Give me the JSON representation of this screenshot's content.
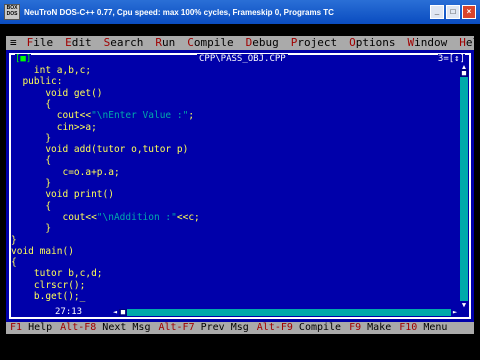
{
  "window": {
    "icon_text": "BOX DOS",
    "title": "NeuTroN DOS-C++ 0.77, Cpu speed: max 100% cycles, Frameskip  0, Programs  TC",
    "buttons": {
      "minimize": "_",
      "maximize": "□",
      "close": "×"
    }
  },
  "menubar": {
    "system": "≡",
    "items": [
      {
        "hot": "F",
        "rest": "ile"
      },
      {
        "hot": "E",
        "rest": "dit"
      },
      {
        "hot": "S",
        "rest": "earch"
      },
      {
        "hot": "R",
        "rest": "un"
      },
      {
        "hot": "C",
        "rest": "ompile"
      },
      {
        "hot": "D",
        "rest": "ebug"
      },
      {
        "hot": "P",
        "rest": "roject"
      },
      {
        "hot": "O",
        "rest": "ptions"
      },
      {
        "hot": "W",
        "rest": "indow"
      },
      {
        "hot": "H",
        "rest": "elp"
      }
    ]
  },
  "editor": {
    "title": "CPP\\PASS_OBJ.CPP",
    "left_marker": "[■]",
    "right_marker": "3=[↕]",
    "cursor_pos": "27:13",
    "lines": [
      {
        "text": "    int a,b,c;",
        "str": "",
        "tail": ""
      },
      {
        "text": "  public:",
        "str": "",
        "tail": ""
      },
      {
        "text": "      void get()",
        "str": "",
        "tail": ""
      },
      {
        "text": "      {",
        "str": "",
        "tail": ""
      },
      {
        "text": "        cout<<",
        "str": "\"\\nEnter Value :\"",
        "tail": ";"
      },
      {
        "text": "        cin>>a;",
        "str": "",
        "tail": ""
      },
      {
        "text": "      }",
        "str": "",
        "tail": ""
      },
      {
        "text": "      void add(tutor o,tutor p)",
        "str": "",
        "tail": ""
      },
      {
        "text": "      {",
        "str": "",
        "tail": ""
      },
      {
        "text": "         c=o.a+p.a;",
        "str": "",
        "tail": ""
      },
      {
        "text": "      }",
        "str": "",
        "tail": ""
      },
      {
        "text": "      void print()",
        "str": "",
        "tail": ""
      },
      {
        "text": "      {",
        "str": "",
        "tail": ""
      },
      {
        "text": "         cout<<",
        "str": "\"\\nAddition :\"",
        "tail": "<<c;"
      },
      {
        "text": "      }",
        "str": "",
        "tail": ""
      },
      {
        "text": "}",
        "str": "",
        "tail": ""
      },
      {
        "text": "void main()",
        "str": "",
        "tail": ""
      },
      {
        "text": "{",
        "str": "",
        "tail": ""
      },
      {
        "text": "    tutor b,c,d;",
        "str": "",
        "tail": ""
      },
      {
        "text": "    clrscr();",
        "str": "",
        "tail": ""
      },
      {
        "text": "    b.get();_",
        "str": "",
        "tail": ""
      }
    ]
  },
  "helpbar": {
    "items": [
      {
        "key": "F1",
        "label": " Help"
      },
      {
        "key": "Alt-F8",
        "label": " Next Msg"
      },
      {
        "key": "Alt-F7",
        "label": " Prev Msg"
      },
      {
        "key": "Alt-F9",
        "label": " Compile"
      },
      {
        "key": "F9",
        "label": " Make"
      },
      {
        "key": "F10",
        "label": " Menu"
      }
    ]
  }
}
